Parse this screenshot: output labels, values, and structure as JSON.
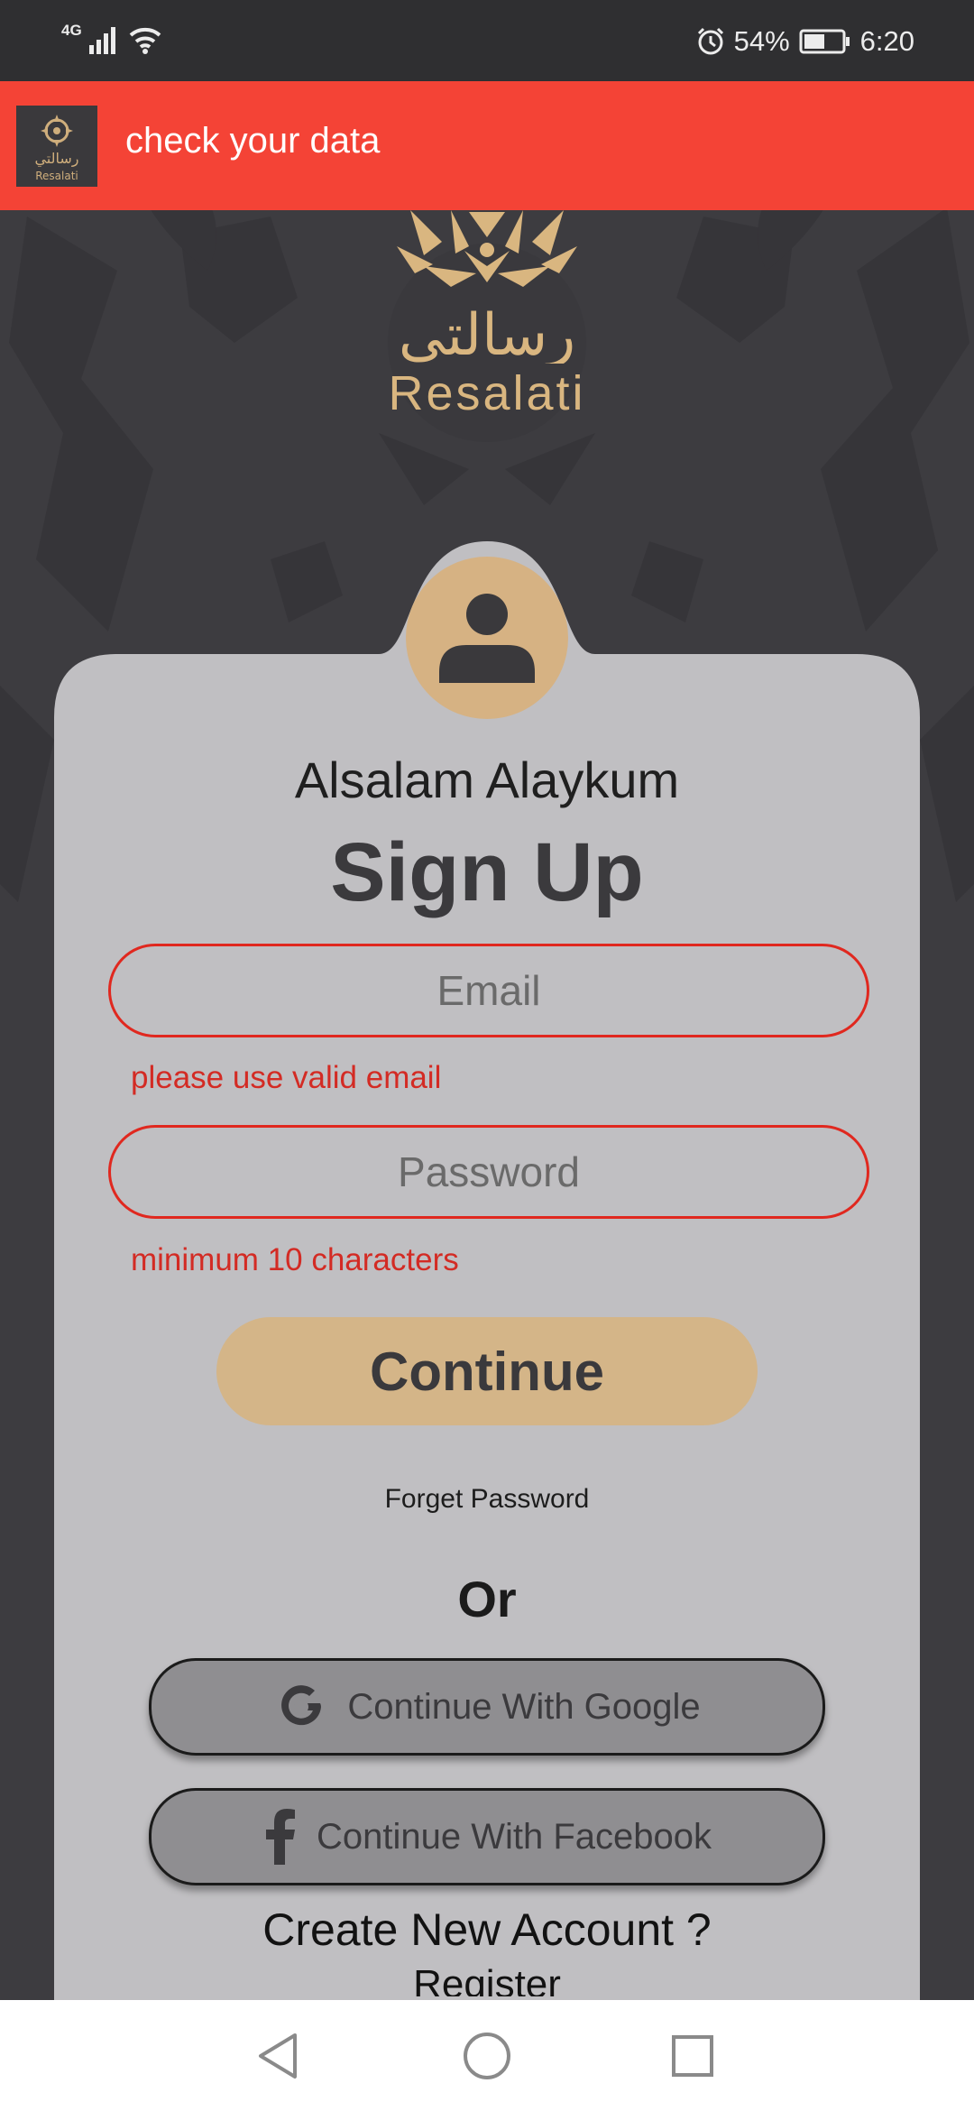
{
  "status_bar": {
    "network": "4G",
    "battery": "54%",
    "time": "6:20"
  },
  "toast": {
    "logo_text_ar": "رسالتي",
    "logo_text_en": "Resalati",
    "message": "check your data"
  },
  "brand": {
    "name_ar": "رسالتي",
    "name_en": "Resalati"
  },
  "form": {
    "greeting": "Alsalam Alaykum",
    "title": "Sign Up",
    "email_placeholder": "Email",
    "email_error": "please use valid email",
    "password_placeholder": "Password",
    "password_error": "minimum 10 characters",
    "continue_label": "Continue",
    "forget_password_label": "Forget Password",
    "or_label": "Or",
    "google_label": "Continue With Google",
    "facebook_label": "Continue With Facebook",
    "create_account_label": "Create New Account ?",
    "register_label": "Register"
  },
  "colors": {
    "background": "#3d3c40",
    "toast": "#f44336",
    "accent_gold": "#d4b588",
    "card": "#c0bfc2",
    "error": "#d32b24"
  },
  "icons": {
    "avatar": "user-icon",
    "google": "google-icon",
    "facebook": "facebook-icon"
  }
}
